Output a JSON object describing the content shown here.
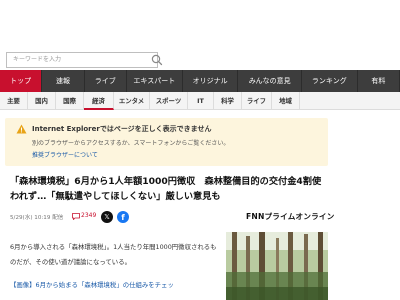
{
  "search": {
    "placeholder": "キーワードを入力"
  },
  "nav_primary": [
    {
      "label": "トップ",
      "active": true
    },
    {
      "label": "速報",
      "active": false
    },
    {
      "label": "ライブ",
      "active": false
    },
    {
      "label": "エキスパート",
      "active": false
    },
    {
      "label": "オリジナル",
      "active": false
    },
    {
      "label": "みんなの意見",
      "active": false
    },
    {
      "label": "ランキング",
      "active": false
    },
    {
      "label": "有料",
      "active": false
    }
  ],
  "nav_secondary": [
    {
      "label": "主要",
      "active": false
    },
    {
      "label": "国内",
      "active": false
    },
    {
      "label": "国際",
      "active": false
    },
    {
      "label": "経済",
      "active": true
    },
    {
      "label": "エンタメ",
      "active": false
    },
    {
      "label": "スポーツ",
      "active": false
    },
    {
      "label": "IT",
      "active": false
    },
    {
      "label": "科学",
      "active": false
    },
    {
      "label": "ライフ",
      "active": false
    },
    {
      "label": "地域",
      "active": false
    }
  ],
  "notice": {
    "title": "Internet Explorerではページを正しく表示できません",
    "body": "別のブラウザーからアクセスするか、スマートフォンからご覧ください。",
    "link": "推奨ブラウザーについて"
  },
  "article": {
    "headline": "「森林環境税」6月から1人年額1000円徴収　森林整備目的の交付金4割使われず…「無駄遣やしてほしくない」厳しい意見も",
    "date": "5/29(水) 10:19 配信",
    "comment_count": "2349",
    "source": "FNNプライムオンライン",
    "body": "6月から導入される「森林環境税」。1人当たり年間1000円徴収されるものだが、その使い道が議論になっている。",
    "related": "【画像】6月から始まる「森林環境税」の仕組みをチェッ"
  },
  "colors": {
    "accent": "#c8102e",
    "nav_bg": "#3d3d3d",
    "link": "#1a5aa8",
    "notice_bg": "#fdf5dd"
  }
}
